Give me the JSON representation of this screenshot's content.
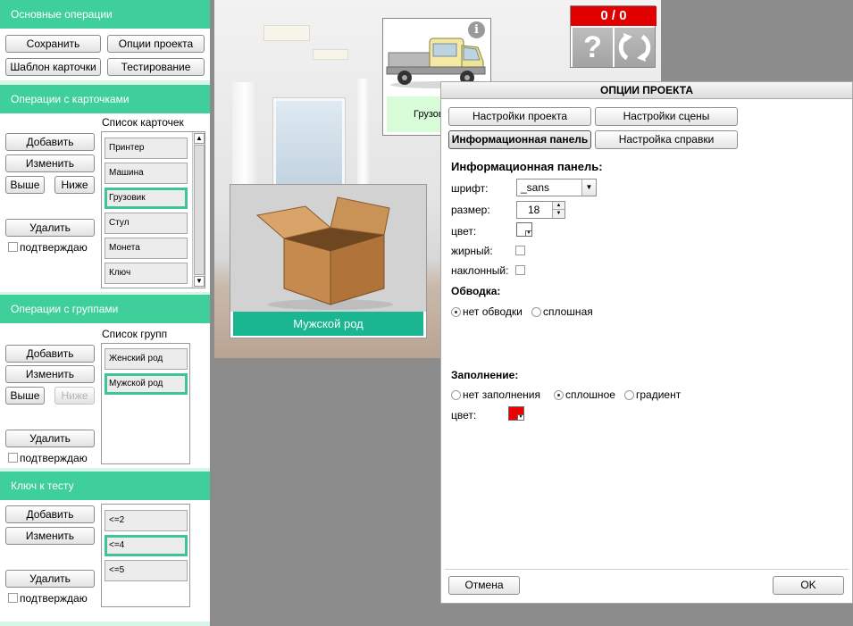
{
  "left_panel": {
    "main_ops": {
      "header": "Основные операции",
      "save": "Сохранить",
      "project_options": "Опции проекта",
      "card_template": "Шаблон карточки",
      "testing": "Тестирование"
    },
    "card_ops": {
      "header": "Операции с карточками",
      "list_label": "Список карточек",
      "add": "Добавить",
      "edit": "Изменить",
      "up": "Выше",
      "down": "Ниже",
      "delete": "Удалить",
      "confirm": "подтверждаю",
      "items": [
        "Принтер",
        "Машина",
        "Грузовик",
        "Стул",
        "Монета",
        "Ключ"
      ],
      "selected_index": 2
    },
    "group_ops": {
      "header": "Операции с группами",
      "list_label": "Список групп",
      "add": "Добавить",
      "edit": "Изменить",
      "up": "Выше",
      "down": "Ниже",
      "delete": "Удалить",
      "confirm": "подтверждаю",
      "items": [
        "Женский род",
        "Мужской род"
      ],
      "selected_index": 1
    },
    "test_key": {
      "header": "Ключ к тесту",
      "add": "Добавить",
      "edit": "Изменить",
      "delete": "Удалить",
      "confirm": "подтверждаю",
      "items": [
        "<=2",
        "<=4",
        "<=5"
      ],
      "selected_index": 1
    }
  },
  "stage": {
    "truck_card_caption": "Грузовик",
    "box_card_caption": "Мужской род",
    "score": "0 / 0",
    "help_glyph": "?"
  },
  "dialog": {
    "title": "ОПЦИИ ПРОЕКТА",
    "tabs": [
      "Настройки проекта",
      "Настройки сцены",
      "Информационная панель",
      "Настройка справки"
    ],
    "active_tab_index": 2,
    "section_title": "Информационная панель:",
    "font_label": "шрифт:",
    "font_value": "_sans",
    "size_label": "размер:",
    "size_value": "18",
    "color_label": "цвет:",
    "bold_label": "жирный:",
    "italic_label": "наклонный:",
    "stroke_title": "Обводка:",
    "stroke_options": [
      "нет обводки",
      "сплошная"
    ],
    "stroke_selected": 0,
    "fill_title": "Заполнение:",
    "fill_options": [
      "нет заполнения",
      "сплошное",
      "градиент"
    ],
    "fill_selected": 1,
    "fill_color_label": "цвет:",
    "fill_color": "#ee0000",
    "cancel": "Отмена",
    "ok": "OK"
  },
  "colors": {
    "panel_header": "#3ecf9a",
    "panel_bg": "#d7f5e6",
    "selection": "#3fc497",
    "score_red": "#e00000"
  }
}
